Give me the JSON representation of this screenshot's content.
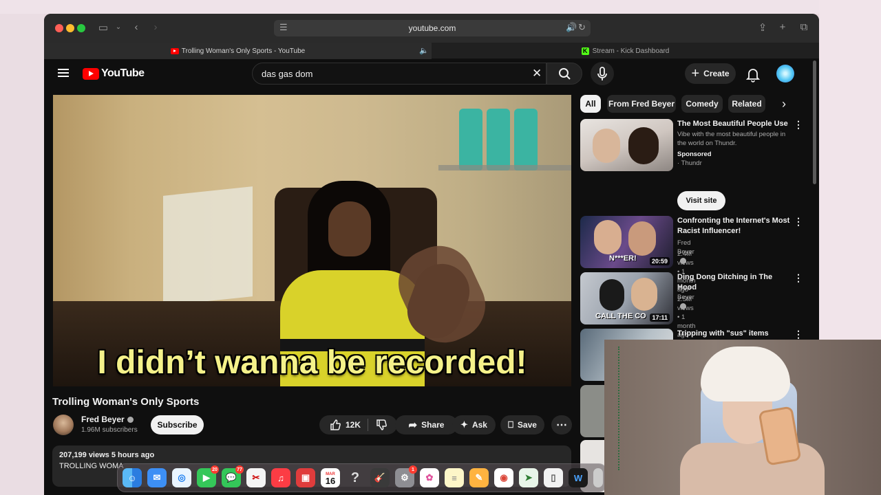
{
  "browser": {
    "url": "youtube.com",
    "tabs": [
      {
        "label": "Trolling Woman's Only Sports - YouTube"
      },
      {
        "label": "Stream - Kick Dashboard"
      }
    ]
  },
  "youtube": {
    "logo_text": "YouTube",
    "search": {
      "value": "das gas dom"
    },
    "create_label": "Create"
  },
  "video": {
    "caption": "I didn’t wanna be recorded!",
    "title": "Trolling Woman's Only Sports",
    "channel": {
      "name": "Fred Beyer",
      "subscribers": "1.96M subscribers"
    },
    "subscribe_label": "Subscribe",
    "likes": "12K",
    "share_label": "Share",
    "ask_label": "Ask",
    "save_label": "Save",
    "description": {
      "stats": "207,199 views  5 hours ago",
      "preview": "TROLLING WOMA"
    }
  },
  "chips": [
    "All",
    "From Fred Beyer",
    "Comedy",
    "Related"
  ],
  "recommendations": [
    {
      "title": "The Most Beautiful People Use",
      "line2": "Vibe with the most beautiful people in the world on Thundr.",
      "sponsored": "Sponsored",
      "advertiser": "Thundr",
      "cta": "Visit site"
    },
    {
      "title": "Confronting the Internet's Most Racist Influencer!",
      "channel": "Fred Beyer",
      "meta": "2.4M views • 1 month ago",
      "duration": "20:59",
      "thumb_text": "N***ER!"
    },
    {
      "title": "Ding Dong Ditching in The Hood",
      "channel": "Fred Beyer",
      "meta": "2.5M views • 1 month ago",
      "duration": "17:11",
      "thumb_text": "CALL THE CO"
    },
    {
      "title": "Tripping with \"sus\" items prank!!"
    }
  ],
  "dock": {
    "badges": {
      "facetime": "20",
      "messages": "77",
      "settings": "1"
    },
    "calendar": {
      "month": "MAR",
      "day": "16"
    }
  },
  "colors": {
    "yt_red": "#ff0000",
    "background": "#0f0f0f",
    "caption": "#f5f28a",
    "kick_green": "#53fc18"
  }
}
